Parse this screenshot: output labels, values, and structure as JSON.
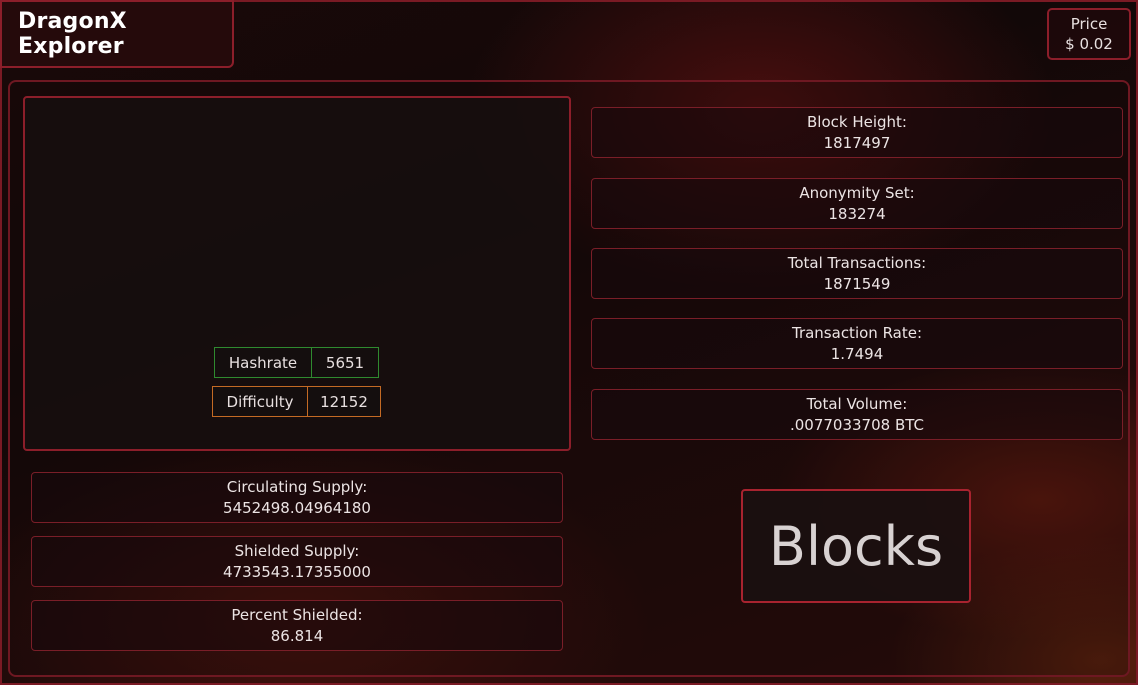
{
  "header": {
    "title": "DragonX Explorer",
    "price_label": "Price",
    "price_value": "$ 0.02"
  },
  "chart_panel": {
    "hashrate_label": "Hashrate",
    "hashrate_value": "5651",
    "difficulty_label": "Difficulty",
    "difficulty_value": "12152"
  },
  "stats_right": [
    {
      "label": "Block Height:",
      "value": "1817497"
    },
    {
      "label": "Anonymity Set:",
      "value": "183274"
    },
    {
      "label": "Total Transactions:",
      "value": "1871549"
    },
    {
      "label": "Transaction Rate:",
      "value": "1.7494"
    },
    {
      "label": "Total Volume:",
      "value": ".0077033708 BTC"
    }
  ],
  "stats_left": [
    {
      "label": "Circulating Supply:",
      "value": "5452498.04964180"
    },
    {
      "label": "Shielded Supply:",
      "value": "4733543.17355000"
    },
    {
      "label": "Percent Shielded:",
      "value": "86.814"
    }
  ],
  "blocks_button": {
    "label": "Blocks"
  },
  "colors": {
    "accent": "#8c1e2a",
    "hashrate_border": "#2f8a2f",
    "difficulty_border": "#c46a24"
  }
}
